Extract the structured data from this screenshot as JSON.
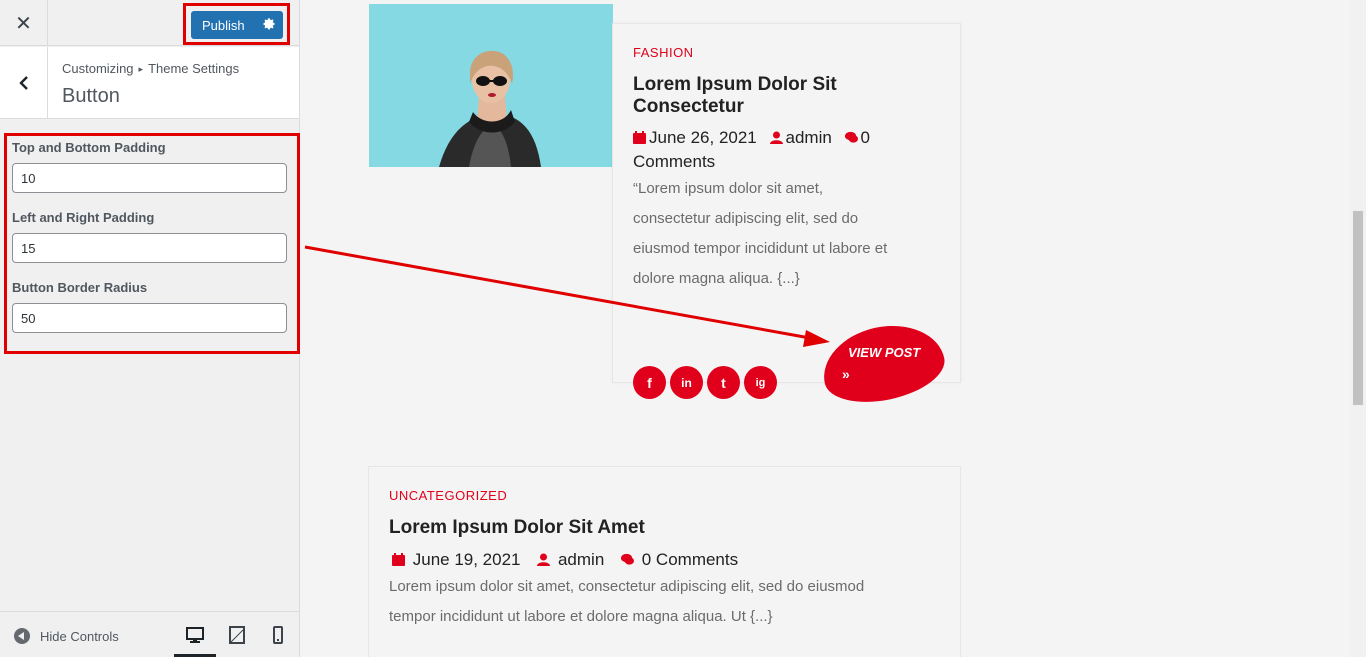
{
  "topbar": {
    "close_label": "✕",
    "publish_label": "Publish"
  },
  "section": {
    "breadcrumb_parent": "Customizing",
    "breadcrumb_sep": "▸",
    "breadcrumb_child": "Theme Settings",
    "title": "Button"
  },
  "controls": {
    "top_bottom_label": "Top and Bottom Padding",
    "top_bottom_value": "10",
    "left_right_label": "Left and Right Padding",
    "left_right_value": "15",
    "radius_label": "Button Border Radius",
    "radius_value": "50"
  },
  "footer": {
    "hide_label": "Hide Controls",
    "devices": [
      "desktop-icon",
      "tablet-icon",
      "mobile-icon"
    ],
    "active_device": "desktop"
  },
  "post1": {
    "category": "FASHION",
    "title": "Lorem Ipsum Dolor Sit Consectetur",
    "date": "June 26, 2021",
    "author": "admin",
    "comments": "0 Comments",
    "excerpt_lines": [
      "“Lorem ipsum dolor sit amet,",
      "consectetur adipiscing elit, sed do",
      "eiusmod tempor incididunt ut labore et",
      "dolore magna aliqua. {...}"
    ],
    "button_label": "VIEW POST",
    "button_arrows": "»",
    "social": [
      "f",
      "in",
      "t",
      "ig"
    ]
  },
  "post2": {
    "category": "UNCATEGORIZED",
    "title": "Lorem Ipsum Dolor Sit Amet",
    "date": "June 19, 2021",
    "author": "admin",
    "comments": "0 Comments",
    "excerpt_lines": [
      "Lorem ipsum dolor sit amet, consectetur adipiscing elit, sed do eiusmod",
      "tempor incididunt ut labore et dolore magna aliqua. Ut {...}"
    ]
  },
  "colors": {
    "accent": "#e0001b",
    "publish": "#2271b1",
    "annotation": "#e00000"
  }
}
